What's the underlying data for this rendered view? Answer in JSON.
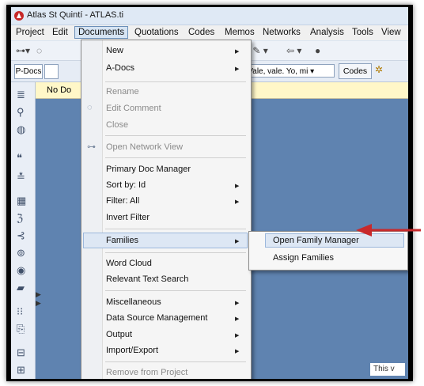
{
  "window": {
    "title": "Atlas St Quintí - ATLAS.ti"
  },
  "menubar": [
    "Project",
    "Edit",
    "Documents",
    "Quotations",
    "Codes",
    "Memos",
    "Networks",
    "Analysis",
    "Tools",
    "View"
  ],
  "toolbar2": {
    "pdocs_label": "P-Docs",
    "combo_value": "1 Vale, vale. Yo, mi ▾",
    "codes_label": "Codes"
  },
  "doc_area": {
    "header_text": "No Do",
    "footer_text": "This v"
  },
  "documents_menu": {
    "items": [
      {
        "label": "New",
        "submenu": true,
        "disabled": false
      },
      {
        "label": "A-Docs",
        "submenu": true,
        "disabled": false
      },
      {
        "label": "Rename",
        "submenu": false,
        "disabled": true
      },
      {
        "label": "Edit Comment",
        "submenu": false,
        "disabled": true,
        "icon": "comment-icon"
      },
      {
        "label": "Close",
        "submenu": false,
        "disabled": true
      },
      {
        "label": "Open Network View",
        "submenu": false,
        "disabled": true,
        "icon": "network-icon"
      },
      {
        "label": "Primary Doc Manager",
        "submenu": false,
        "disabled": false
      },
      {
        "label": "Sort by: Id",
        "submenu": true,
        "disabled": false
      },
      {
        "label": "Filter: All",
        "submenu": true,
        "disabled": false
      },
      {
        "label": "Invert Filter",
        "submenu": false,
        "disabled": false
      },
      {
        "label": "Families",
        "submenu": true,
        "disabled": false,
        "highlighted": true
      },
      {
        "label": "Word Cloud",
        "submenu": false,
        "disabled": false
      },
      {
        "label": "Relevant Text Search",
        "submenu": false,
        "disabled": false
      },
      {
        "label": "Miscellaneous",
        "submenu": true,
        "disabled": false
      },
      {
        "label": "Data Source Management",
        "submenu": true,
        "disabled": false
      },
      {
        "label": "Output",
        "submenu": true,
        "disabled": false
      },
      {
        "label": "Import/Export",
        "submenu": true,
        "disabled": false
      },
      {
        "label": "Remove from Project",
        "submenu": false,
        "disabled": true
      }
    ]
  },
  "families_submenu": {
    "items": [
      {
        "label": "Open Family Manager",
        "highlighted": true
      },
      {
        "label": "Assign Families"
      }
    ]
  },
  "colors": {
    "accent_arrow": "#c8292b",
    "highlight": "#dde7f4",
    "doc_area": "#5f83b0"
  }
}
